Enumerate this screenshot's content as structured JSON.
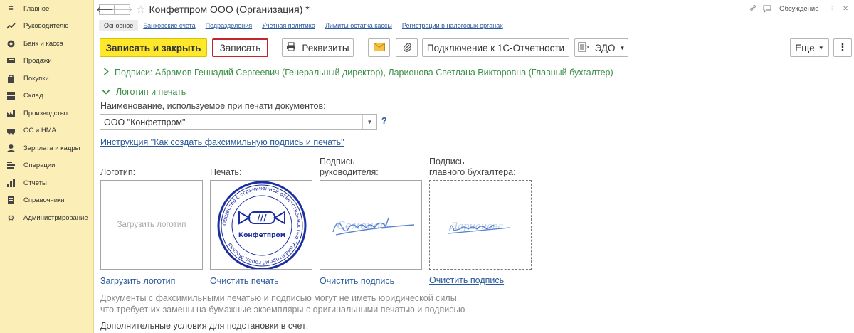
{
  "sidebar": {
    "items": [
      {
        "label": "Главное",
        "icon": "menu-icon"
      },
      {
        "label": "Руководителю",
        "icon": "chart-icon"
      },
      {
        "label": "Банк и касса",
        "icon": "coin-icon"
      },
      {
        "label": "Продажи",
        "icon": "cart-icon"
      },
      {
        "label": "Покупки",
        "icon": "bag-icon"
      },
      {
        "label": "Склад",
        "icon": "warehouse-icon"
      },
      {
        "label": "Производство",
        "icon": "factory-icon"
      },
      {
        "label": "ОС и НМА",
        "icon": "assets-icon"
      },
      {
        "label": "Зарплата и кадры",
        "icon": "person-icon"
      },
      {
        "label": "Операции",
        "icon": "operations-icon"
      },
      {
        "label": "Отчеты",
        "icon": "reports-icon"
      },
      {
        "label": "Справочники",
        "icon": "book-icon"
      },
      {
        "label": "Администрирование",
        "icon": "gear-icon"
      }
    ]
  },
  "header": {
    "back": "🡐",
    "forward": "🡒",
    "star": "☆",
    "title": "Конфетпром ООО (Организация) *",
    "discussion": "Обсуждение",
    "more": "⋮",
    "close": "✕"
  },
  "tabs": [
    "Основное",
    "Банковские счета",
    "Подразделения",
    "Учетная политика",
    "Лимиты остатка кассы",
    "Регистрации в налоговых органах"
  ],
  "toolbar": {
    "save_close": "Записать и закрыть",
    "save": "Записать",
    "requisites": "Реквизиты",
    "connect": "Подключение к 1С-Отчетности",
    "edo": "ЭДО",
    "more": "Еще",
    "menu": "⋮"
  },
  "signatures_section": "Подписи: Абрамов Геннадий Сергеевич (Генеральный директор), Ларионова Светлана Викторовна (Главный бухгалтер)",
  "logo_section": "Логотип и печать",
  "print_name": {
    "label": "Наименование, используемое при печати документов:",
    "value": "ООО \"Конфетпром\"",
    "help": "?"
  },
  "instruction_link": "Инструкция \"Как создать факсимильную подпись и печать\"",
  "images": {
    "logo_label": "Логотип:",
    "stamp_label": "Печать:",
    "director_label_1": "Подпись",
    "director_label_2": "руководителя:",
    "accountant_label_1": "Подпись",
    "accountant_label_2": "главного бухгалтера:",
    "logo_placeholder": "Загрузить логотип",
    "stamp_ring_text": "Общество с ограниченной ответственностью \"Конфетпром\" город Москва",
    "stamp_name": "Конфетпром",
    "stamp_candy": "///",
    "director_signature": "Семенов",
    "accountant_signature": "Ларионова"
  },
  "actions": {
    "upload_logo": "Загрузить логотип",
    "clear_stamp": "Очистить печать",
    "clear_director": "Очистить подпись",
    "clear_accountant": "Очистить подпись"
  },
  "note_line1": "Документы с факсимильными печатью и подписью могут не иметь юридической силы,",
  "note_line2": "что требует их замены на бумажные экземпляры с оригинальными печатью и подписью",
  "extra_label": "Дополнительные условия для подстановки в счет:",
  "colors": {
    "sidebar_bg": "#fbeeb6",
    "accent_yellow": "#ffe72c",
    "link_blue": "#2b5a9b",
    "section_green": "#3b8f47",
    "stamp_blue": "#1c2fa0",
    "highlight_red": "#c0272d"
  }
}
